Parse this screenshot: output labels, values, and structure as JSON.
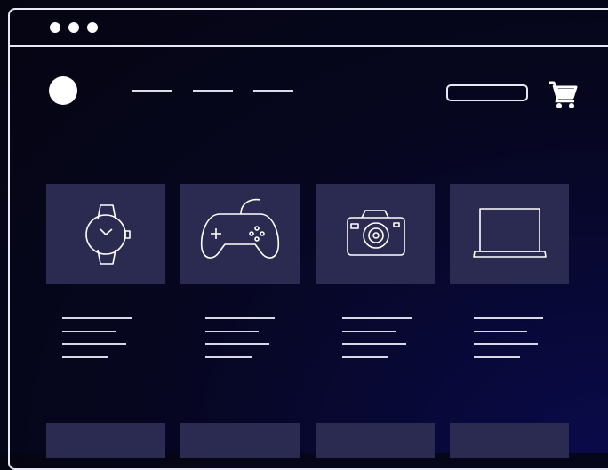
{
  "window": {
    "controls": [
      "window-dot-1",
      "window-dot-2",
      "window-dot-3"
    ]
  },
  "header": {
    "logo_icon": "circle-logo-icon",
    "nav_items": [
      "nav-placeholder-1",
      "nav-placeholder-2",
      "nav-placeholder-3"
    ],
    "search_icon": "search-bar",
    "cart_icon": "cart-icon"
  },
  "products": [
    {
      "icon": "watch-icon"
    },
    {
      "icon": "gamepad-icon"
    },
    {
      "icon": "camera-icon"
    },
    {
      "icon": "laptop-icon"
    }
  ],
  "colors": {
    "background": "#06061f",
    "card": "#2b2a50",
    "stroke": "#e8e8f2"
  }
}
